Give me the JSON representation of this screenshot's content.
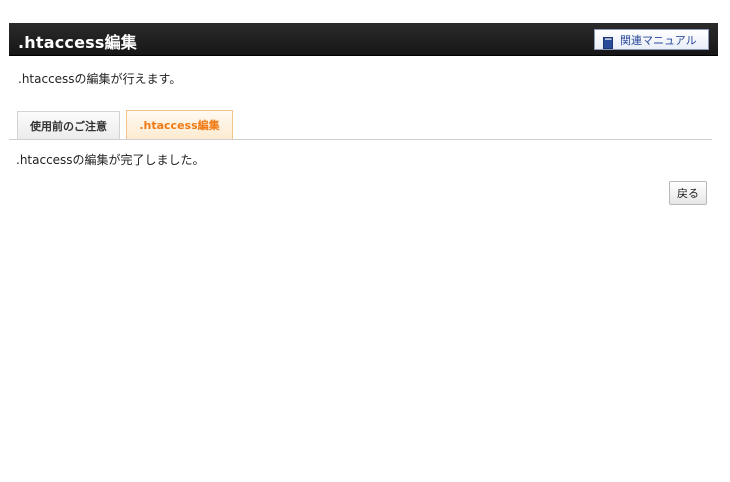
{
  "header": {
    "title": ".htaccess編集",
    "manual_button_label": "関連マニュアル",
    "manual_icon": "book-icon"
  },
  "description": ".htaccessの編集が行えます。",
  "tabs": [
    {
      "label": "使用前のご注意",
      "active": false
    },
    {
      "label": ".htaccess編集",
      "active": true
    }
  ],
  "status_message": ".htaccessの編集が完了しました。",
  "back_button_label": "戻る",
  "colors": {
    "header_background": "#1f1f1f",
    "active_tab_text": "#f07a14",
    "manual_link_text": "#2a4a9a"
  }
}
